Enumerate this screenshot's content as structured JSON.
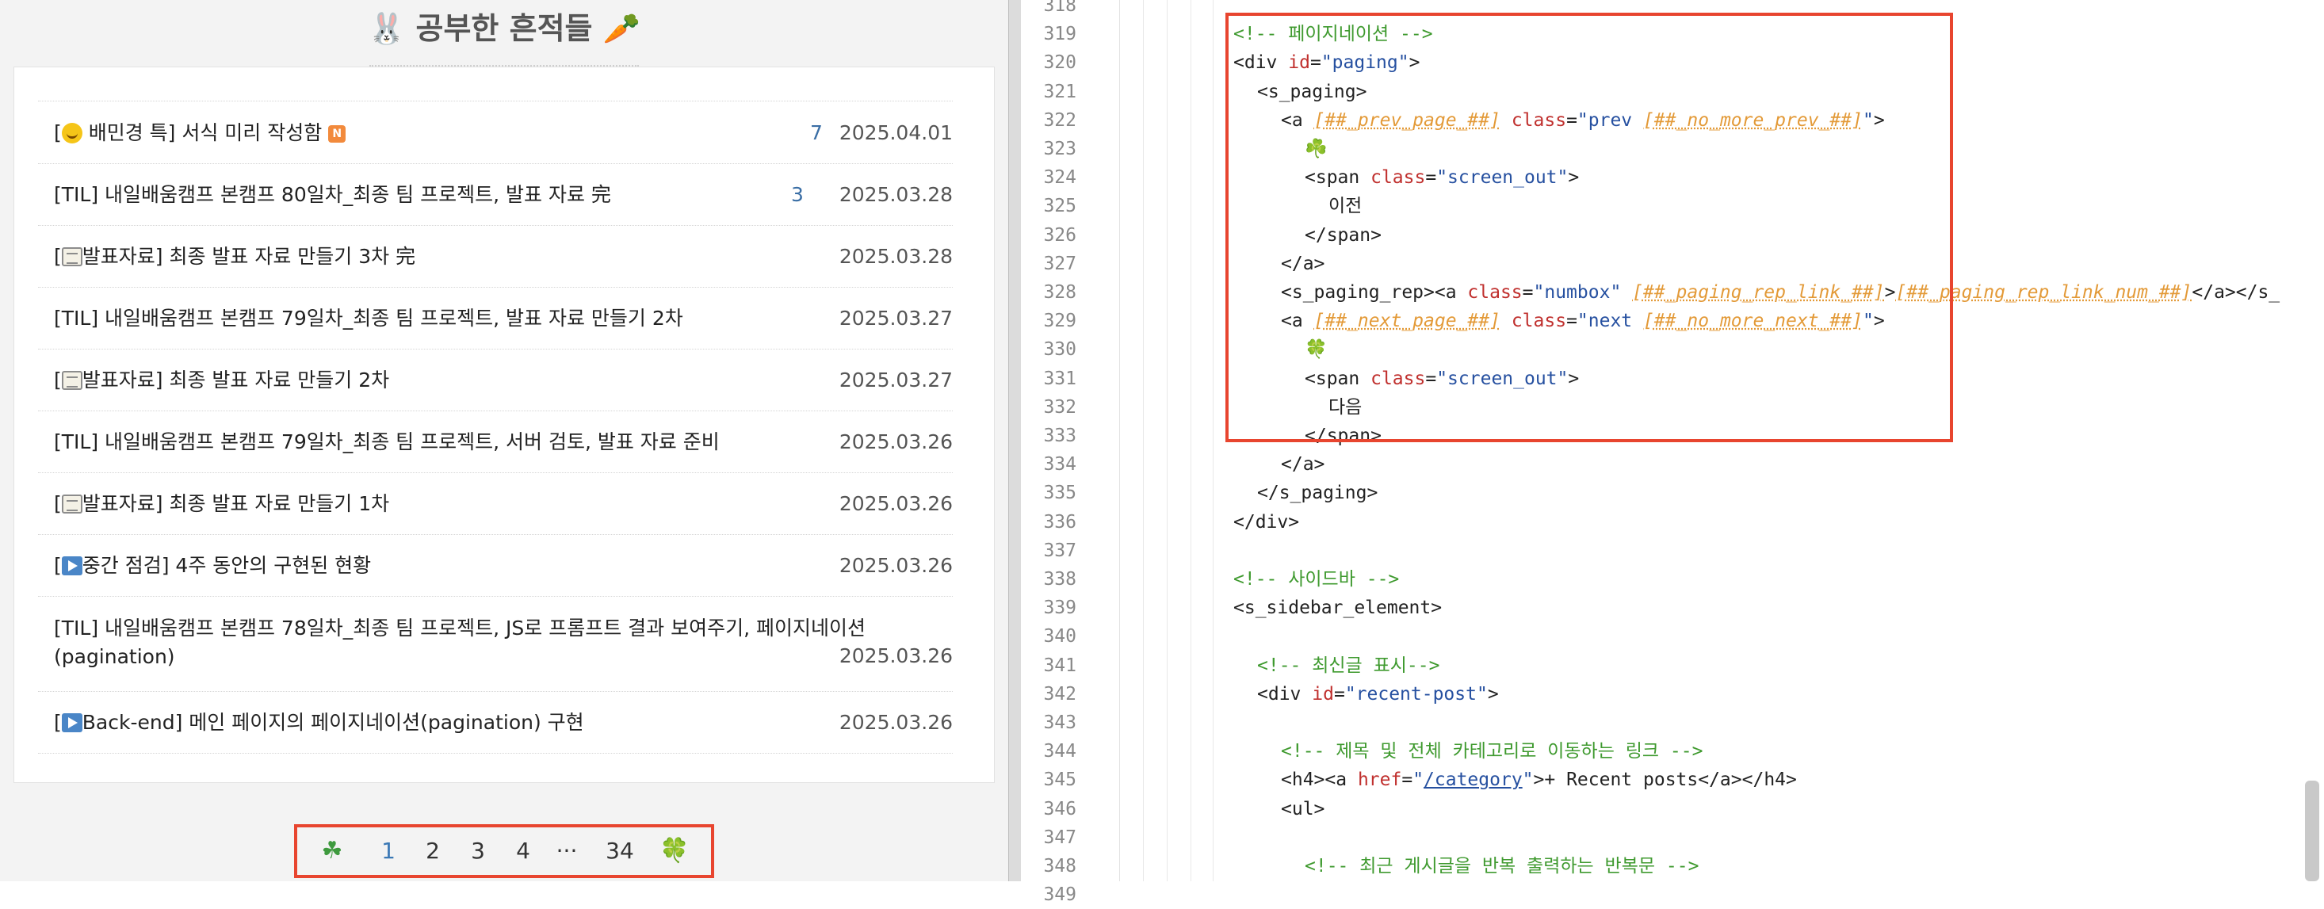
{
  "blog": {
    "title": "🐰 공부한 흔적들 🥕"
  },
  "posts": [
    {
      "icon": "face-icon",
      "prefix": "[",
      "title": " 배민경 특] 서식 미리 작성함",
      "badge": "N",
      "count": "7",
      "date": "2025.04.01"
    },
    {
      "icon": "",
      "prefix": "",
      "title": "[TIL] 내일배움캠프 본캠프 80일차_최종 팀 프로젝트, 발표 자료 完",
      "badge": "",
      "count": "3",
      "date": "2025.03.28"
    },
    {
      "icon": "memo-icon",
      "prefix": "[",
      "title": "발표자료] 최종 발표 자료 만들기 3차 完",
      "badge": "",
      "count": "",
      "date": "2025.03.28"
    },
    {
      "icon": "",
      "prefix": "",
      "title": "[TIL] 내일배움캠프 본캠프 79일차_최종 팀 프로젝트, 발표 자료 만들기 2차",
      "badge": "",
      "count": "",
      "date": "2025.03.27"
    },
    {
      "icon": "memo-icon",
      "prefix": "[",
      "title": "발표자료] 최종 발표 자료 만들기 2차",
      "badge": "",
      "count": "",
      "date": "2025.03.27"
    },
    {
      "icon": "",
      "prefix": "",
      "title": "[TIL] 내일배움캠프 본캠프 79일차_최종 팀 프로젝트, 서버 검토, 발표 자료 준비",
      "badge": "",
      "count": "",
      "date": "2025.03.26"
    },
    {
      "icon": "memo-icon",
      "prefix": "[",
      "title": "발표자료] 최종 발표 자료 만들기 1차",
      "badge": "",
      "count": "",
      "date": "2025.03.26"
    },
    {
      "icon": "play-icon",
      "prefix": "[",
      "title": "중간 점검] 4주 동안의 구현된 현황",
      "badge": "",
      "count": "",
      "date": "2025.03.26"
    },
    {
      "icon": "",
      "prefix": "",
      "title": "[TIL] 내일배움캠프 본캠프 78일차_최종 팀 프로젝트, JS로 프롬프트 결과 보여주기, 페이지네이션(pagination)",
      "badge": "",
      "count": "",
      "date": "2025.03.26"
    },
    {
      "icon": "play-icon",
      "prefix": "[",
      "title": "Back-end] 메인 페이지의 페이지네이션(pagination) 구현",
      "badge": "",
      "count": "",
      "date": "2025.03.26"
    }
  ],
  "pagination": {
    "prev": "☘",
    "pages": [
      "1",
      "2",
      "3",
      "4",
      "···",
      "34"
    ],
    "current": "1",
    "next": "🍀"
  },
  "editor": {
    "lines": [
      {
        "n": "318",
        "indent": 0,
        "tokens": []
      },
      {
        "n": "319",
        "indent": 0,
        "tokens": [
          [
            "cmt",
            "<!-- 페이지네이션 -->"
          ]
        ]
      },
      {
        "n": "320",
        "indent": 0,
        "tokens": [
          [
            "tag",
            "<div "
          ],
          [
            "attr",
            "id"
          ],
          [
            "tag",
            "="
          ],
          [
            "str",
            "\"paging\""
          ],
          [
            "tag",
            ">"
          ]
        ]
      },
      {
        "n": "321",
        "indent": 1,
        "tokens": [
          [
            "tag",
            "<s_paging>"
          ]
        ]
      },
      {
        "n": "322",
        "indent": 2,
        "tokens": [
          [
            "tag",
            "<a "
          ],
          [
            "var",
            "[##_prev_page_##]"
          ],
          [
            "tag",
            " "
          ],
          [
            "attr",
            "class"
          ],
          [
            "tag",
            "="
          ],
          [
            "str",
            "\"prev "
          ],
          [
            "var",
            "[##_no_more_prev_##]"
          ],
          [
            "str",
            "\""
          ],
          [
            "tag",
            ">"
          ]
        ]
      },
      {
        "n": "323",
        "indent": 3,
        "tokens": [
          [
            "green",
            "☘️"
          ]
        ]
      },
      {
        "n": "324",
        "indent": 3,
        "tokens": [
          [
            "tag",
            "<span "
          ],
          [
            "attr",
            "class"
          ],
          [
            "tag",
            "="
          ],
          [
            "str",
            "\"screen_out\""
          ],
          [
            "tag",
            ">"
          ]
        ]
      },
      {
        "n": "325",
        "indent": 4,
        "tokens": [
          [
            "tag",
            "이전"
          ]
        ]
      },
      {
        "n": "326",
        "indent": 3,
        "tokens": [
          [
            "tag",
            "</span>"
          ]
        ]
      },
      {
        "n": "327",
        "indent": 2,
        "tokens": [
          [
            "tag",
            "</a>"
          ]
        ]
      },
      {
        "n": "328",
        "indent": 2,
        "tokens": [
          [
            "tag",
            "<s_paging_rep><a "
          ],
          [
            "attr",
            "class"
          ],
          [
            "tag",
            "="
          ],
          [
            "str",
            "\"numbox\" "
          ],
          [
            "var",
            "[##_paging_rep_link_##]"
          ],
          [
            "tag",
            ">"
          ],
          [
            "var",
            "[##_paging_rep_link_num_##]"
          ],
          [
            "tag",
            "</a></s_"
          ]
        ]
      },
      {
        "n": "329",
        "indent": 2,
        "tokens": [
          [
            "tag",
            "<a "
          ],
          [
            "var",
            "[##_next_page_##]"
          ],
          [
            "tag",
            " "
          ],
          [
            "attr",
            "class"
          ],
          [
            "tag",
            "="
          ],
          [
            "str",
            "\"next "
          ],
          [
            "var",
            "[##_no_more_next_##]"
          ],
          [
            "str",
            "\""
          ],
          [
            "tag",
            ">"
          ]
        ]
      },
      {
        "n": "330",
        "indent": 3,
        "tokens": [
          [
            "green",
            "🍀"
          ]
        ]
      },
      {
        "n": "331",
        "indent": 3,
        "tokens": [
          [
            "tag",
            "<span "
          ],
          [
            "attr",
            "class"
          ],
          [
            "tag",
            "="
          ],
          [
            "str",
            "\"screen_out\""
          ],
          [
            "tag",
            ">"
          ]
        ]
      },
      {
        "n": "332",
        "indent": 4,
        "tokens": [
          [
            "tag",
            "다음"
          ]
        ]
      },
      {
        "n": "333",
        "indent": 3,
        "tokens": [
          [
            "tag",
            "</span>"
          ]
        ]
      },
      {
        "n": "334",
        "indent": 2,
        "tokens": [
          [
            "tag",
            "</a>"
          ]
        ]
      },
      {
        "n": "335",
        "indent": 1,
        "tokens": [
          [
            "tag",
            "</s_paging>"
          ]
        ]
      },
      {
        "n": "336",
        "indent": 0,
        "tokens": [
          [
            "tag",
            "</div>"
          ]
        ]
      },
      {
        "n": "337",
        "indent": 0,
        "tokens": []
      },
      {
        "n": "338",
        "indent": 0,
        "tokens": [
          [
            "cmt",
            "<!-- 사이드바 -->"
          ]
        ]
      },
      {
        "n": "339",
        "indent": 0,
        "tokens": [
          [
            "tag",
            "<s_sidebar_element>"
          ]
        ]
      },
      {
        "n": "340",
        "indent": 0,
        "tokens": []
      },
      {
        "n": "341",
        "indent": 1,
        "tokens": [
          [
            "cmt",
            "<!-- 최신글 표시-->"
          ]
        ]
      },
      {
        "n": "342",
        "indent": 1,
        "tokens": [
          [
            "tag",
            "<div "
          ],
          [
            "attr",
            "id"
          ],
          [
            "tag",
            "="
          ],
          [
            "str",
            "\"recent-post\""
          ],
          [
            "tag",
            ">"
          ]
        ]
      },
      {
        "n": "343",
        "indent": 0,
        "tokens": []
      },
      {
        "n": "344",
        "indent": 2,
        "tokens": [
          [
            "cmt",
            "<!-- 제목 및 전체 카테고리로 이동하는 링크 -->"
          ]
        ]
      },
      {
        "n": "345",
        "indent": 2,
        "tokens": [
          [
            "tag",
            "<h4><a "
          ],
          [
            "attr",
            "href"
          ],
          [
            "tag",
            "="
          ],
          [
            "str",
            "\""
          ],
          [
            "link",
            "/category"
          ],
          [
            "str",
            "\""
          ],
          [
            "tag",
            ">+ Recent posts</a></h4>"
          ]
        ]
      },
      {
        "n": "346",
        "indent": 2,
        "tokens": [
          [
            "tag",
            "<ul>"
          ]
        ]
      },
      {
        "n": "347",
        "indent": 0,
        "tokens": []
      },
      {
        "n": "348",
        "indent": 3,
        "tokens": [
          [
            "cmt",
            "<!-- 최근 게시글을 반복 출력하는 반복문 -->"
          ]
        ]
      },
      {
        "n": "349",
        "indent": 0,
        "tokens": []
      }
    ]
  },
  "colors": {
    "highlight_border": "#e8452f",
    "comment": "#3f9a2f",
    "attribute": "#c0302e",
    "string": "#2650a0",
    "template_var": "#e39a38"
  }
}
